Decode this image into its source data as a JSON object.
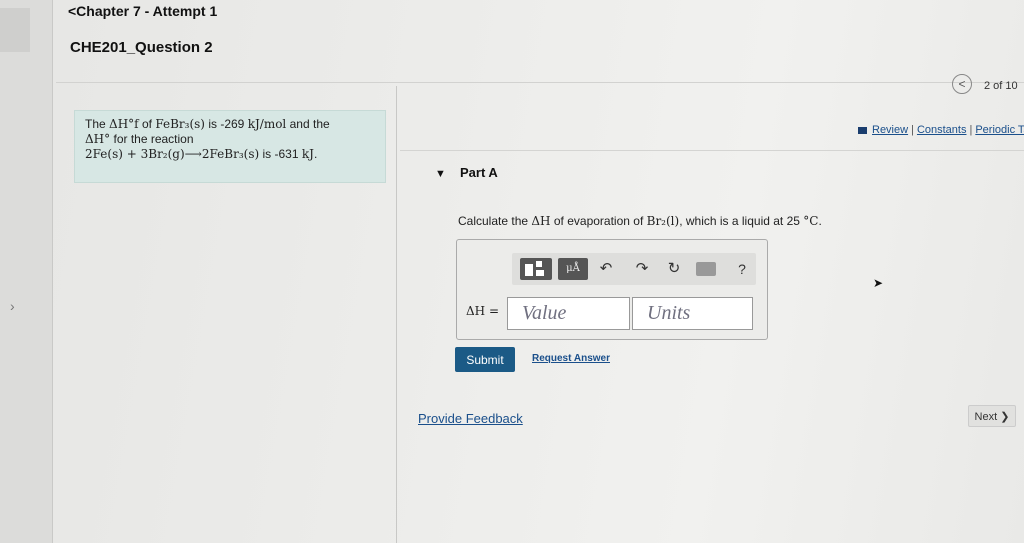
{
  "header": {
    "chapter_link": "<Chapter 7 - Attempt 1",
    "question_title": "CHE201_Question 2"
  },
  "pager": {
    "prev_icon": "chevron-left-icon",
    "prev_symbol": "<",
    "count": "2 of 10"
  },
  "links": {
    "review": "Review",
    "constants": "Constants",
    "periodic": "Periodic Tab",
    "sep": "|"
  },
  "info": {
    "t1": "The",
    "dHf": "ΔH°f",
    "t2": "of",
    "compound": "FeBr₃(s)",
    "t3": "is -269",
    "unit1": "kJ/mol",
    "t4": "and the",
    "dH": "ΔH°",
    "t5": "for the reaction",
    "reaction": "2Fe(s) + 3Br₂(g)⟶2FeBr₃(s)",
    "t6": "is -631",
    "unit2": "kJ",
    "t7": "."
  },
  "part": {
    "label": "Part A",
    "toggle_symbol": "▼"
  },
  "prompt": {
    "t1": "Calculate the",
    "dH": "ΔH",
    "t2": "of evaporation of",
    "species": "Br₂(l)",
    "t3": ", which is a liquid at 25",
    "temp_unit": "°C",
    "t4": "."
  },
  "toolbar": {
    "units_label": "μÅ",
    "undo_symbol": "↶",
    "redo_symbol": "↷",
    "reset_symbol": "↻",
    "help_symbol": "?"
  },
  "answer": {
    "label": "ΔH =",
    "value_placeholder": "Value",
    "units_placeholder": "Units"
  },
  "actions": {
    "submit": "Submit",
    "request_answer": "Request Answer",
    "feedback": "Provide Feedback",
    "next": "Next ❯"
  },
  "colors": {
    "submit_bg": "#1b5a86",
    "link": "#1a4f8b",
    "info_bg": "#d7e7e4"
  }
}
